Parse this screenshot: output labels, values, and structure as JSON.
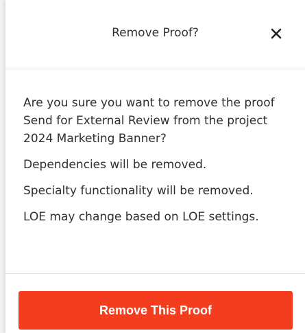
{
  "dialog": {
    "title": "Remove Proof?",
    "close_icon": "close-icon",
    "messages": [
      "Are you sure you want to remove the proof Send for External Review from the project 2024 Marketing Banner?",
      "Dependencies will be removed.",
      "Specialty functionality will be removed.",
      "LOE may change based on LOE settings."
    ],
    "confirm_label": "Remove This Proof",
    "accent_color": "#f43c1f"
  }
}
